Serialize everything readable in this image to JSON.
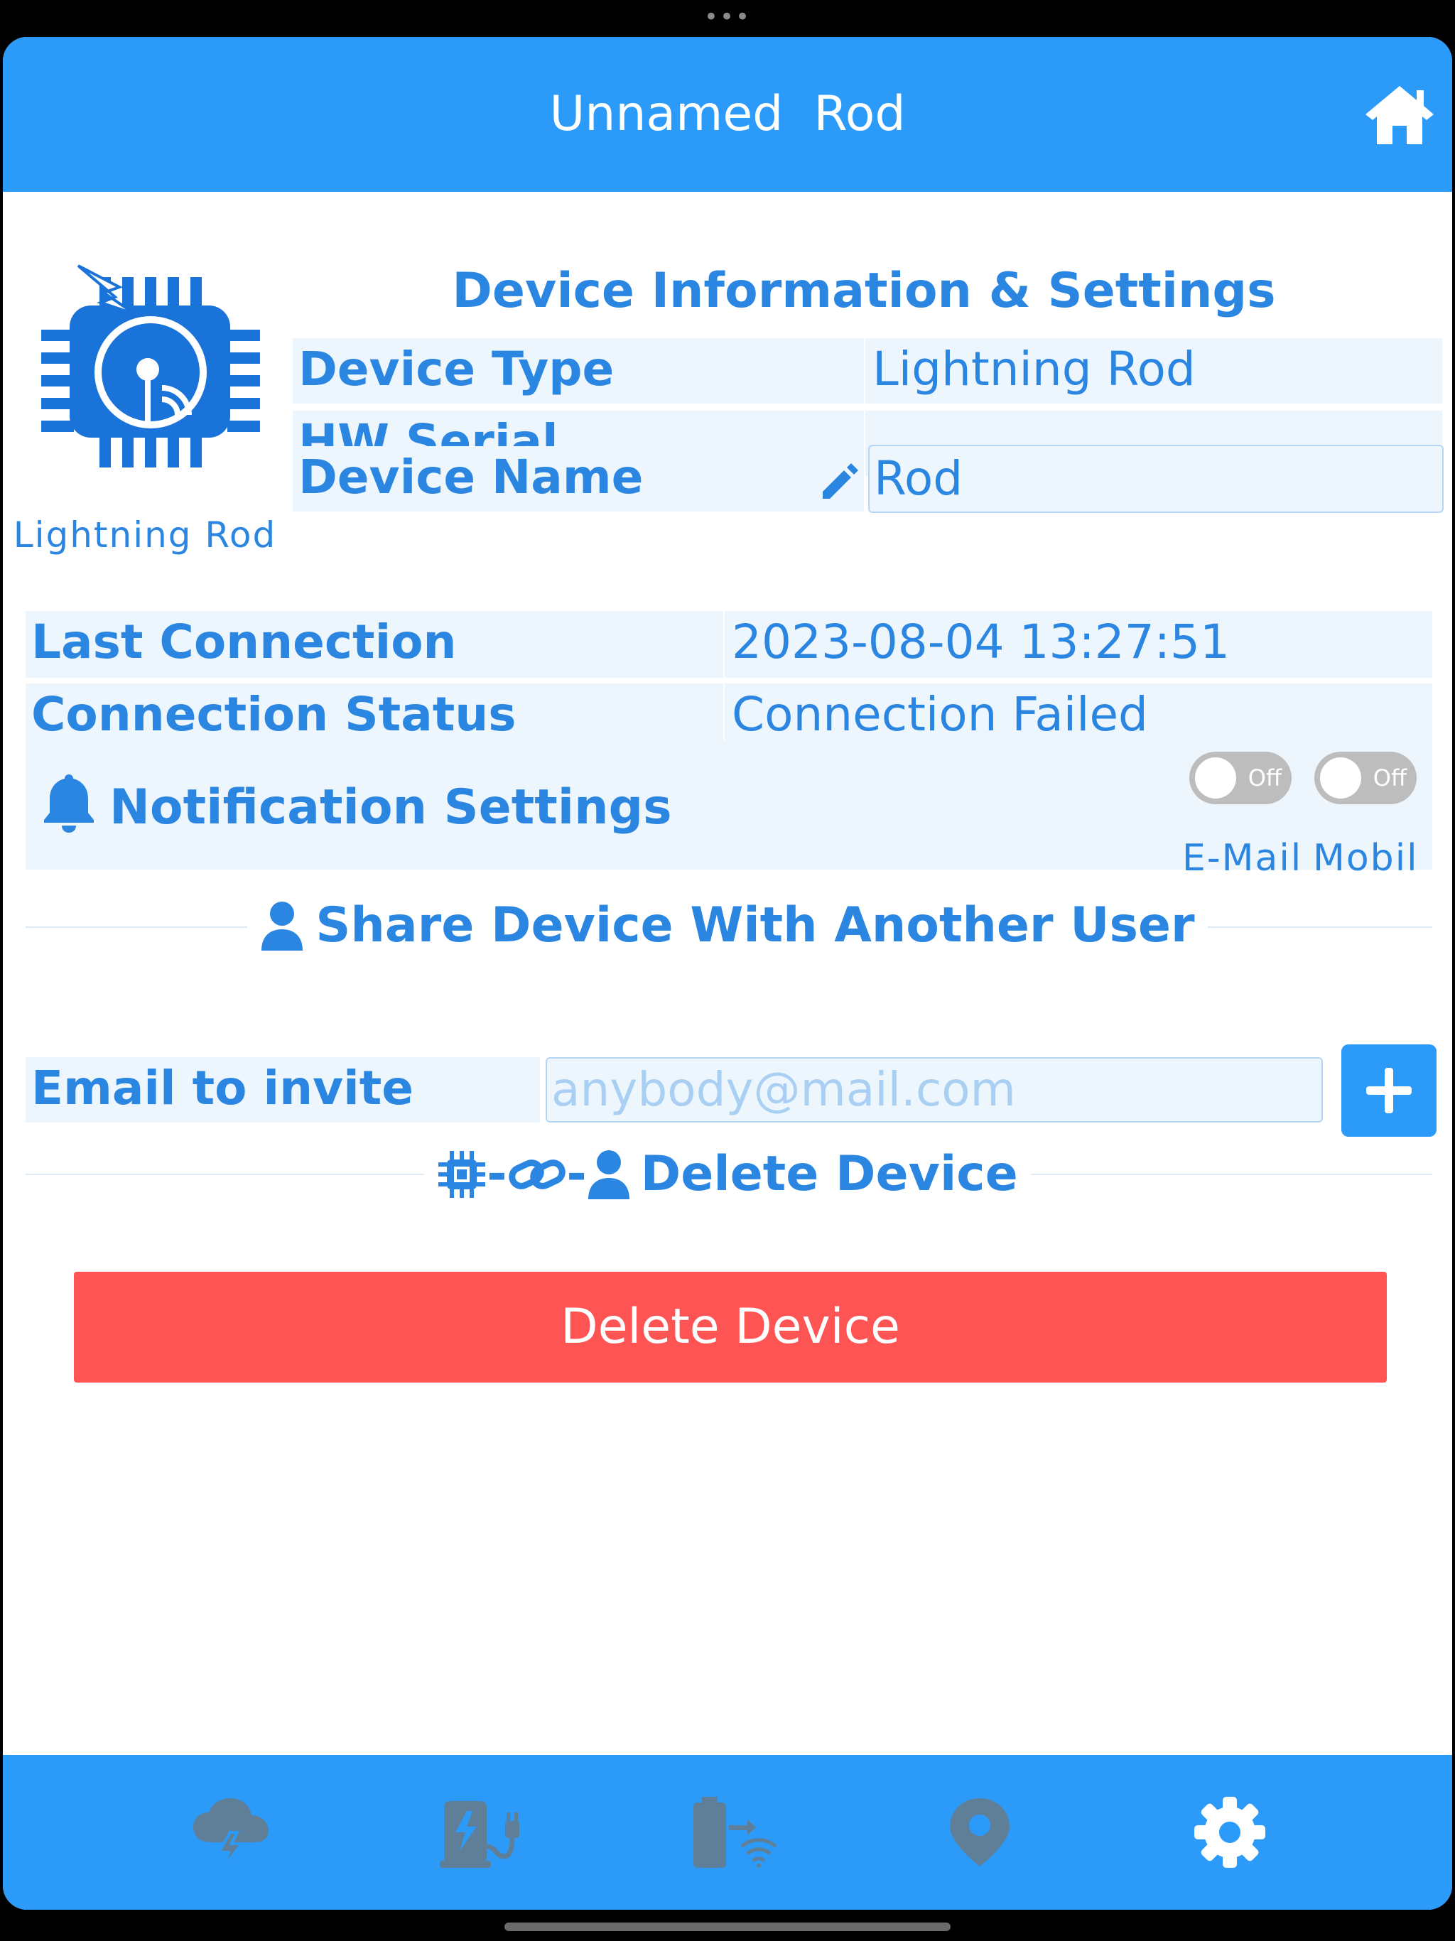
{
  "header": {
    "title": "Unnamed  Rod"
  },
  "device": {
    "logo_caption": "Lightning Rod",
    "section_title": "Device Information & Settings",
    "type_label": "Device Type",
    "type_value": "Lightning Rod",
    "serial_label": "HW Serial",
    "serial_value": "",
    "name_label": "Device Name",
    "name_value": "Rod"
  },
  "connection": {
    "last_label": "Last Connection",
    "last_value": "2023-08-04 13:27:51",
    "status_label": "Connection Status",
    "status_value": "Connection Failed"
  },
  "notifications": {
    "title": "Notification Settings",
    "email_toggle": "Off",
    "email_label": "E-Mail",
    "mobile_toggle": "Off",
    "mobile_label": "Mobil"
  },
  "share": {
    "title": "Share Device With Another User",
    "email_label": "Email to invite",
    "email_placeholder": "anybody@mail.com"
  },
  "delete": {
    "section_title": "Delete Device",
    "button_label": "Delete Device"
  },
  "colors": {
    "primary": "#2b9af9",
    "text_blue": "#2b86e2",
    "cell_bg": "#eef6fd",
    "danger": "#ff5454",
    "inactive_tab_icon": "#5f7f98",
    "active_tab_icon": "#ffffff"
  },
  "tabs": [
    {
      "icon": "storm-cloud-icon",
      "active": false
    },
    {
      "icon": "charging-station-icon",
      "active": false
    },
    {
      "icon": "battery-wireless-icon",
      "active": false
    },
    {
      "icon": "location-pin-icon",
      "active": false
    },
    {
      "icon": "gear-icon",
      "active": true
    }
  ]
}
